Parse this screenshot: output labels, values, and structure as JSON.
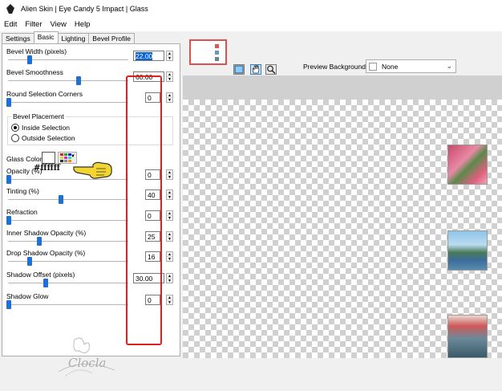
{
  "window": {
    "title": "Alien Skin | Eye Candy 5 Impact | Glass"
  },
  "menu": [
    "Edit",
    "Filter",
    "View",
    "Help"
  ],
  "tabs": [
    "Settings",
    "Basic",
    "Lighting",
    "Bevel Profile"
  ],
  "settings": {
    "bevel_width": {
      "label": "Bevel Width (pixels)",
      "value": "22.00",
      "level": 0.15
    },
    "bevel_smoothness": {
      "label": "Bevel Smoothness",
      "value": "60.00",
      "level": 0.6
    },
    "round_corners": {
      "label": "Round Selection Corners",
      "value": "0",
      "level": 0.0
    },
    "bevel_placement": {
      "title": "Bevel Placement",
      "options": [
        "Inside Selection",
        "Outside Selection"
      ],
      "selected": "Inside Selection"
    },
    "glass_color": {
      "label": "Glass Color",
      "annotation": "#ffffff"
    },
    "opacity": {
      "label": "Opacity (%)",
      "value": "0",
      "level": 0.0
    },
    "tinting": {
      "label": "Tinting (%)",
      "value": "40",
      "level": 0.4
    },
    "refraction": {
      "label": "Refraction",
      "value": "0",
      "level": 0.0
    },
    "inner_shadow": {
      "label": "Inner Shadow Opacity (%)",
      "value": "25",
      "level": 0.25
    },
    "drop_shadow": {
      "label": "Drop Shadow Opacity (%)",
      "value": "16",
      "level": 0.16
    },
    "shadow_offset": {
      "label": "Shadow Offset (pixels)",
      "value": "30.00",
      "level": 0.3
    },
    "shadow_glow": {
      "label": "Shadow Glow",
      "value": "0",
      "level": 0.0
    }
  },
  "preview": {
    "background_label": "Preview Background:",
    "background_value": "None"
  },
  "watermark": "Clocla",
  "colors": {
    "highlight_box": "#e02020",
    "slider_thumb": "#1e70d2",
    "selection": "#0a64d8"
  }
}
